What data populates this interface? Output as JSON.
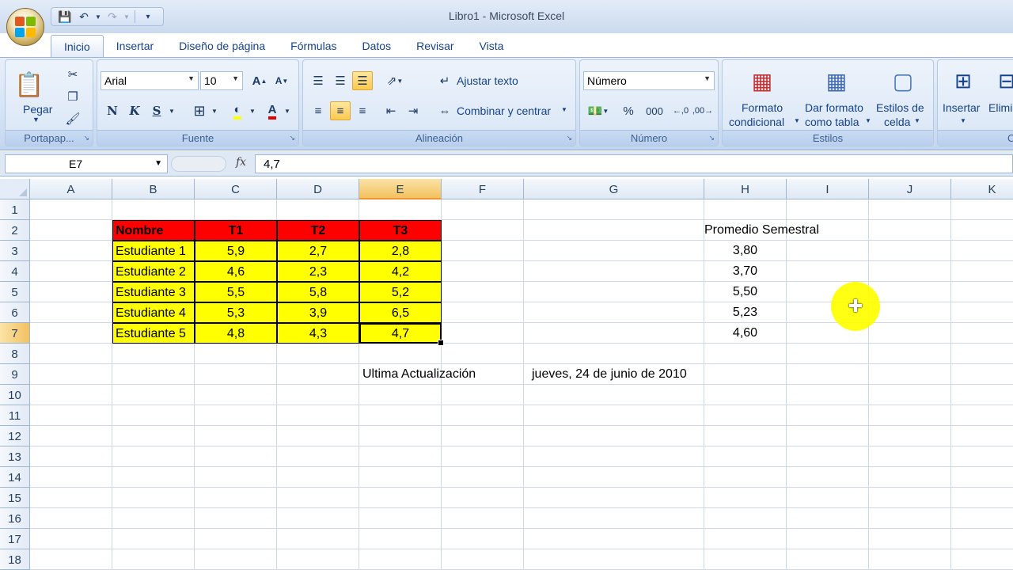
{
  "window": {
    "title": "Libro1 - Microsoft Excel"
  },
  "qat": {
    "save_icon": "save-icon",
    "undo_icon": "undo-icon",
    "redo_icon": "redo-icon",
    "customize_icon": "customize-icon"
  },
  "tabs": [
    {
      "label": "Inicio",
      "active": true
    },
    {
      "label": "Insertar"
    },
    {
      "label": "Diseño de página"
    },
    {
      "label": "Fórmulas"
    },
    {
      "label": "Datos"
    },
    {
      "label": "Revisar"
    },
    {
      "label": "Vista"
    }
  ],
  "ribbon": {
    "clipboard": {
      "label": "Portapap...",
      "paste": "Pegar"
    },
    "font": {
      "label": "Fuente",
      "family": "Arial",
      "size": "10",
      "bold": "N",
      "italic": "K",
      "underline": "S"
    },
    "alignment": {
      "label": "Alineación",
      "wrap": "Ajustar texto",
      "merge": "Combinar y centrar"
    },
    "number": {
      "label": "Número",
      "format": "Número",
      "percent": "%",
      "thousands": "000"
    },
    "styles": {
      "label": "Estilos",
      "conditional_1": "Formato",
      "conditional_2": "condicional",
      "table_1": "Dar formato",
      "table_2": "como tabla",
      "cell_1": "Estilos de",
      "cell_2": "celda"
    },
    "cells": {
      "label": "Cel",
      "insert": "Insertar",
      "delete": "Elimi"
    }
  },
  "formula_bar": {
    "name_box": "E7",
    "fx": "fx",
    "formula": "4,7"
  },
  "columns": [
    "A",
    "B",
    "C",
    "D",
    "E",
    "F",
    "G",
    "H",
    "I",
    "J",
    "K"
  ],
  "selected_column": "E",
  "selected_row": "7",
  "rows": [
    "1",
    "2",
    "3",
    "4",
    "5",
    "6",
    "7",
    "8",
    "9",
    "10",
    "11",
    "12",
    "13",
    "14",
    "15",
    "16",
    "17",
    "18"
  ],
  "table": {
    "headers": [
      "Nombre",
      "T1",
      "T2",
      "T3"
    ],
    "data": [
      [
        "Estudiante 1",
        "5,9",
        "2,7",
        "2,8"
      ],
      [
        "Estudiante 2",
        "4,6",
        "2,3",
        "4,2"
      ],
      [
        "Estudiante 3",
        "5,5",
        "5,8",
        "5,2"
      ],
      [
        "Estudiante 4",
        "5,3",
        "3,9",
        "6,5"
      ],
      [
        "Estudiante 5",
        "4,8",
        "4,3",
        "4,7"
      ]
    ]
  },
  "summary": {
    "title": "Promedio Semestral",
    "values": [
      "3,80",
      "3,70",
      "5,50",
      "5,23",
      "4,60"
    ]
  },
  "update": {
    "label": "Ultima Actualización",
    "date": "jueves, 24 de junio de 2010"
  },
  "colors": {
    "header_fill": "#ff0000",
    "data_fill": "#ffff00",
    "selection": "#f3c15f"
  }
}
